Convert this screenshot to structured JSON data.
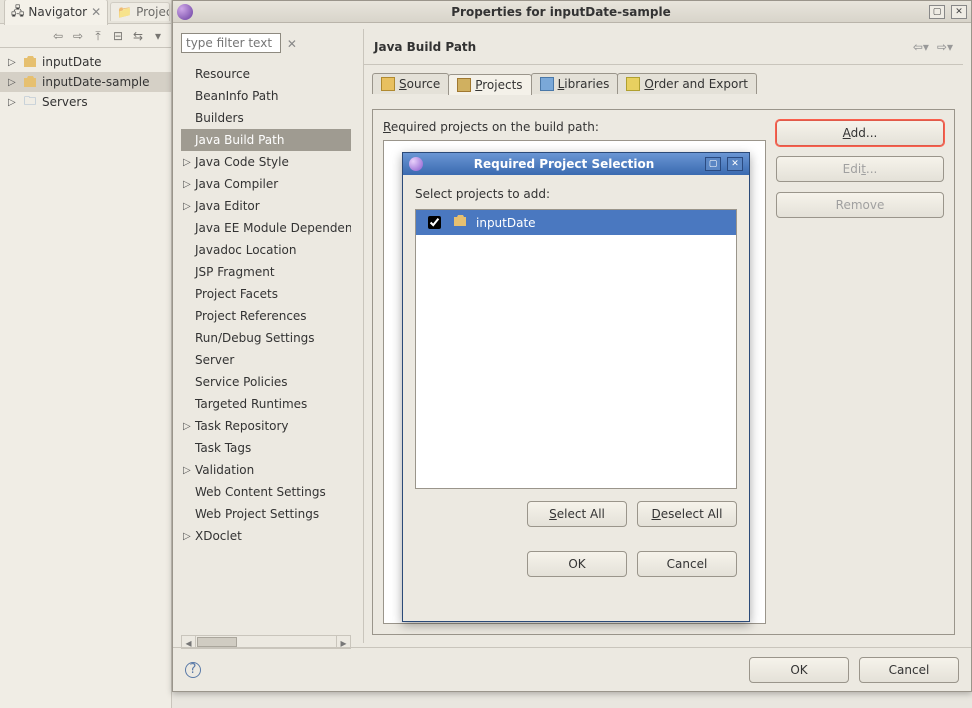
{
  "navigator": {
    "tabs": [
      "Navigator",
      "Project Exp"
    ],
    "toolbar_icons": [
      "back-icon",
      "fwd-icon",
      "up-icon",
      "collapse-icon",
      "link-icon",
      "menu-icon"
    ],
    "items": [
      {
        "label": "inputDate"
      },
      {
        "label": "inputDate-sample"
      },
      {
        "label": "Servers"
      }
    ]
  },
  "window": {
    "title": "Properties for inputDate-sample",
    "filter_placeholder": "type filter text",
    "categories": [
      {
        "label": "Resource",
        "expand": false
      },
      {
        "label": "BeanInfo Path",
        "expand": false
      },
      {
        "label": "Builders",
        "expand": false
      },
      {
        "label": "Java Build Path",
        "expand": false,
        "selected": true
      },
      {
        "label": "Java Code Style",
        "expand": true
      },
      {
        "label": "Java Compiler",
        "expand": true
      },
      {
        "label": "Java Editor",
        "expand": true
      },
      {
        "label": "Java EE Module Dependencies",
        "expand": false
      },
      {
        "label": "Javadoc Location",
        "expand": false
      },
      {
        "label": "JSP Fragment",
        "expand": false
      },
      {
        "label": "Project Facets",
        "expand": false
      },
      {
        "label": "Project References",
        "expand": false
      },
      {
        "label": "Run/Debug Settings",
        "expand": false
      },
      {
        "label": "Server",
        "expand": false
      },
      {
        "label": "Service Policies",
        "expand": false
      },
      {
        "label": "Targeted Runtimes",
        "expand": false
      },
      {
        "label": "Task Repository",
        "expand": true
      },
      {
        "label": "Task Tags",
        "expand": false
      },
      {
        "label": "Validation",
        "expand": true
      },
      {
        "label": "Web Content Settings",
        "expand": false
      },
      {
        "label": "Web Project Settings",
        "expand": false
      },
      {
        "label": "XDoclet",
        "expand": true
      }
    ],
    "page_title": "Java Build Path",
    "tabs": {
      "source": "Source",
      "projects": "Projects",
      "libraries": "Libraries",
      "order": "Order and Export"
    },
    "req_label_pre": "R",
    "req_label_post": "equired projects on the build path:",
    "buttons": {
      "add": "Add...",
      "edit": "Edit...",
      "remove": "Remove",
      "ok": "OK",
      "cancel": "Cancel"
    }
  },
  "dialog": {
    "title": "Required Project Selection",
    "label": "Select projects to add:",
    "items": [
      {
        "label": "inputDate",
        "checked": true
      }
    ],
    "buttons": {
      "select_all": "Select All",
      "deselect_all": "Deselect All",
      "ok": "OK",
      "cancel": "Cancel"
    }
  }
}
